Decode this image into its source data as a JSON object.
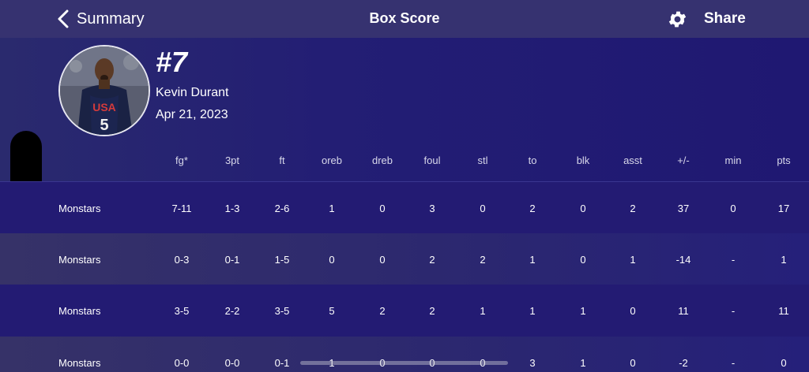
{
  "nav": {
    "back_label": "Summary",
    "title": "Box Score",
    "share_label": "Share",
    "settings_icon": "gear-icon",
    "back_icon": "chevron-left-icon"
  },
  "player": {
    "number": "#7",
    "name": "Kevin Durant",
    "date": "Apr 21, 2023"
  },
  "columns": [
    "fg*",
    "3pt",
    "ft",
    "oreb",
    "dreb",
    "foul",
    "stl",
    "to",
    "blk",
    "asst",
    "+/-",
    "min",
    "pts"
  ],
  "rows": [
    {
      "team": "Monstars",
      "stats": [
        "7-11",
        "1-3",
        "2-6",
        "1",
        "0",
        "3",
        "0",
        "2",
        "0",
        "2",
        "37",
        "0",
        "17"
      ]
    },
    {
      "team": "Monstars",
      "stats": [
        "0-3",
        "0-1",
        "1-5",
        "0",
        "0",
        "2",
        "2",
        "1",
        "0",
        "1",
        "-14",
        "-",
        "1"
      ]
    },
    {
      "team": "Monstars",
      "stats": [
        "3-5",
        "2-2",
        "3-5",
        "5",
        "2",
        "2",
        "1",
        "1",
        "1",
        "0",
        "11",
        "-",
        "11"
      ]
    },
    {
      "team": "Monstars",
      "stats": [
        "0-0",
        "0-0",
        "0-1",
        "1",
        "0",
        "0",
        "0",
        "3",
        "1",
        "0",
        "-2",
        "-",
        "0"
      ]
    }
  ]
}
